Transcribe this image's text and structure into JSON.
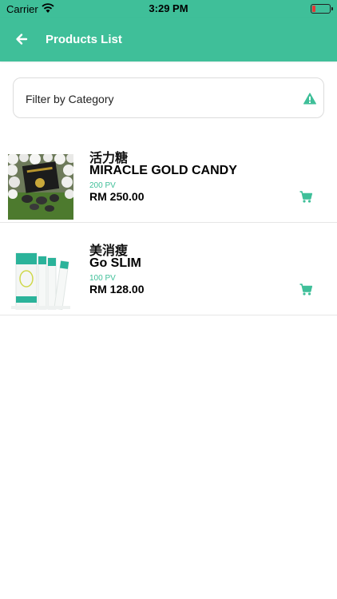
{
  "status_bar": {
    "carrier": "Carrier",
    "time": "3:29 PM"
  },
  "nav": {
    "title": "Products List",
    "back_icon": "arrow-left-icon"
  },
  "filter": {
    "label": "Filter by Category",
    "icon": "warning-triangle-icon"
  },
  "products": [
    {
      "name_cn": "活力糖",
      "name_en": "MIRACLE GOLD CANDY",
      "pv": "200 PV",
      "price": "RM 250.00"
    },
    {
      "name_cn": "美消瘦",
      "name_en": "Go SLIM",
      "pv": "100 PV",
      "price": "RM 128.00"
    }
  ],
  "colors": {
    "accent": "#3fbf99",
    "battery_low": "#e53935"
  }
}
